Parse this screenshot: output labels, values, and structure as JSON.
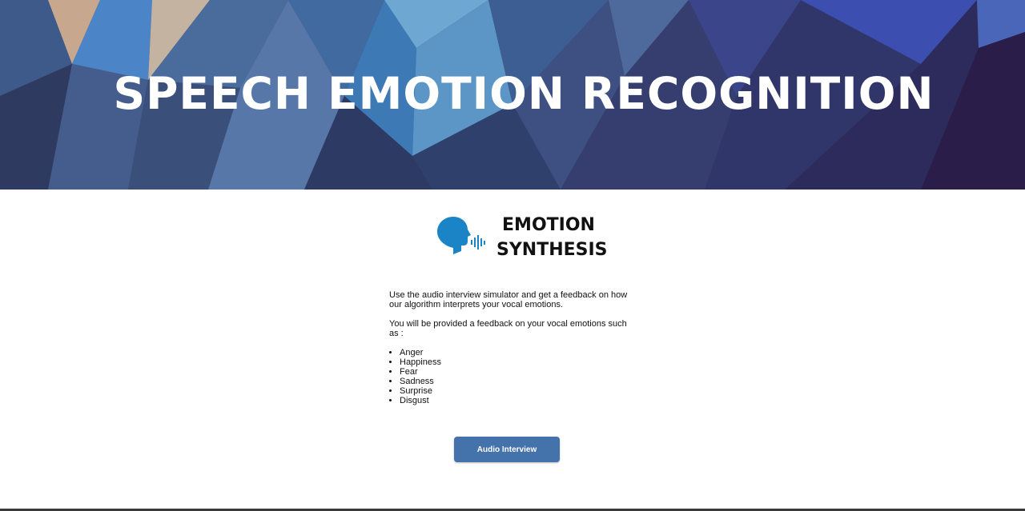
{
  "header": {
    "title": "SPEECH EMOTION RECOGNITION"
  },
  "logo": {
    "icon": "speaking-head-icon",
    "line1": "EMOTION",
    "line2": "SYNTHESIS",
    "color": "#1b84c6"
  },
  "intro": {
    "paragraph1": "Use the audio interview simulator and get a feedback on how our algorithm interprets your vocal emotions.",
    "paragraph2": "You will be provided a feedback on your vocal emotions such as :",
    "emotions": [
      "Anger",
      "Happiness",
      "Fear",
      "Sadness",
      "Surprise",
      "Disgust"
    ]
  },
  "actions": {
    "audio_interview_label": "Audio Interview",
    "button_color": "#4472aa"
  }
}
